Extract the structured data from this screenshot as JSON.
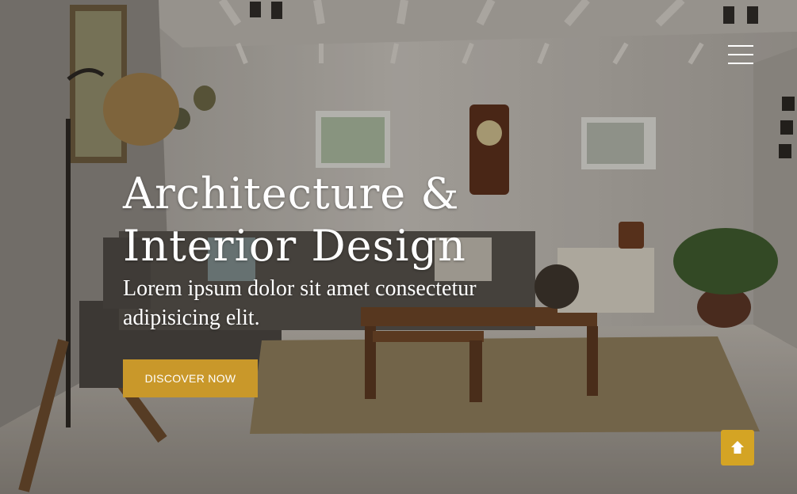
{
  "hero": {
    "title_line_1": "Architecture &",
    "title_line_2": "Interior Design",
    "subtitle": "Lorem ipsum dolor sit amet consectetur adipisicing elit.",
    "cta_label": "DISCOVER NOW",
    "background_image": "living-room-interior-photo"
  },
  "header": {
    "menu_icon": "hamburger-menu-icon"
  },
  "back_to_top": {
    "icon": "arrow-up-icon"
  },
  "colors": {
    "accent": "#c9982a",
    "back_to_top": "#d4a424",
    "text": "#ffffff"
  }
}
